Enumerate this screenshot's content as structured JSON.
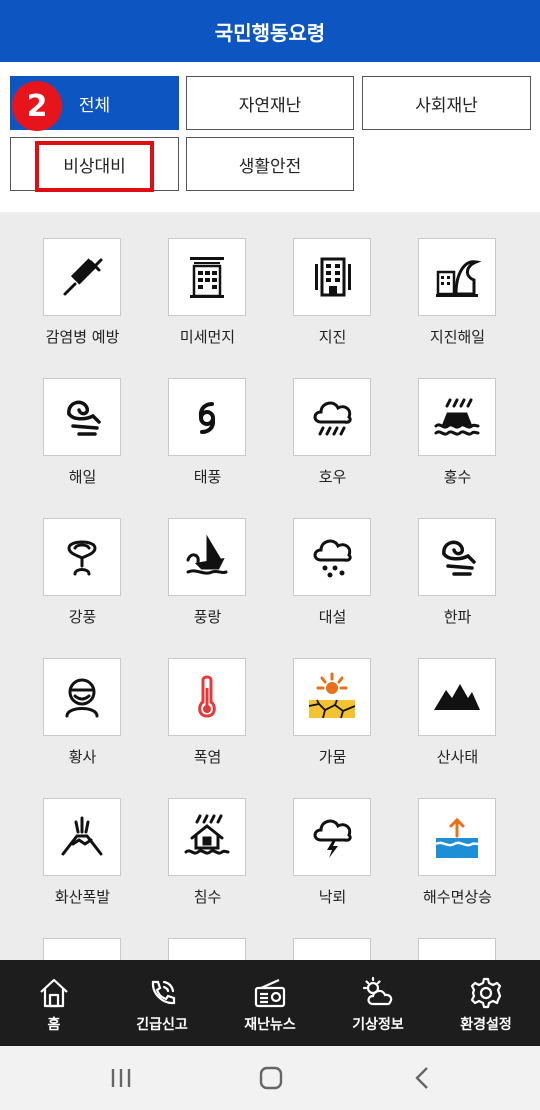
{
  "header": {
    "title": "국민행동요령"
  },
  "step_badge": "2",
  "filters": [
    {
      "label": "전체",
      "active": true
    },
    {
      "label": "자연재난",
      "active": false
    },
    {
      "label": "사회재난",
      "active": false
    },
    {
      "label": "비상대비",
      "active": false
    },
    {
      "label": "생활안전",
      "active": false
    }
  ],
  "items": [
    {
      "label": "감염병 예방",
      "icon": "syringe-icon"
    },
    {
      "label": "미세먼지",
      "icon": "fine-dust-building-icon"
    },
    {
      "label": "지진",
      "icon": "earthquake-building-icon"
    },
    {
      "label": "지진해일",
      "icon": "tsunami-building-icon"
    },
    {
      "label": "해일",
      "icon": "wave-icon"
    },
    {
      "label": "태풍",
      "icon": "typhoon-icon"
    },
    {
      "label": "호우",
      "icon": "rain-cloud-icon"
    },
    {
      "label": "홍수",
      "icon": "flood-car-icon"
    },
    {
      "label": "강풍",
      "icon": "tornado-icon"
    },
    {
      "label": "풍랑",
      "icon": "sailboat-wave-icon"
    },
    {
      "label": "대설",
      "icon": "snow-cloud-icon"
    },
    {
      "label": "한파",
      "icon": "cold-wave-icon"
    },
    {
      "label": "황사",
      "icon": "mask-person-icon"
    },
    {
      "label": "폭염",
      "icon": "thermometer-icon"
    },
    {
      "label": "가뭄",
      "icon": "drought-sun-icon"
    },
    {
      "label": "산사태",
      "icon": "mountain-icon"
    },
    {
      "label": "화산폭발",
      "icon": "volcano-icon"
    },
    {
      "label": "침수",
      "icon": "flooded-house-icon"
    },
    {
      "label": "낙뢰",
      "icon": "lightning-cloud-icon"
    },
    {
      "label": "해수면상승",
      "icon": "sea-level-rise-icon"
    }
  ],
  "nav": [
    {
      "label": "홈",
      "icon": "home-icon"
    },
    {
      "label": "긴급신고",
      "icon": "phone-icon"
    },
    {
      "label": "재난뉴스",
      "icon": "radio-icon"
    },
    {
      "label": "기상정보",
      "icon": "weather-icon"
    },
    {
      "label": "환경설정",
      "icon": "gear-icon"
    }
  ],
  "colors": {
    "brand": "#0d56c2",
    "highlight": "#e00d12"
  }
}
